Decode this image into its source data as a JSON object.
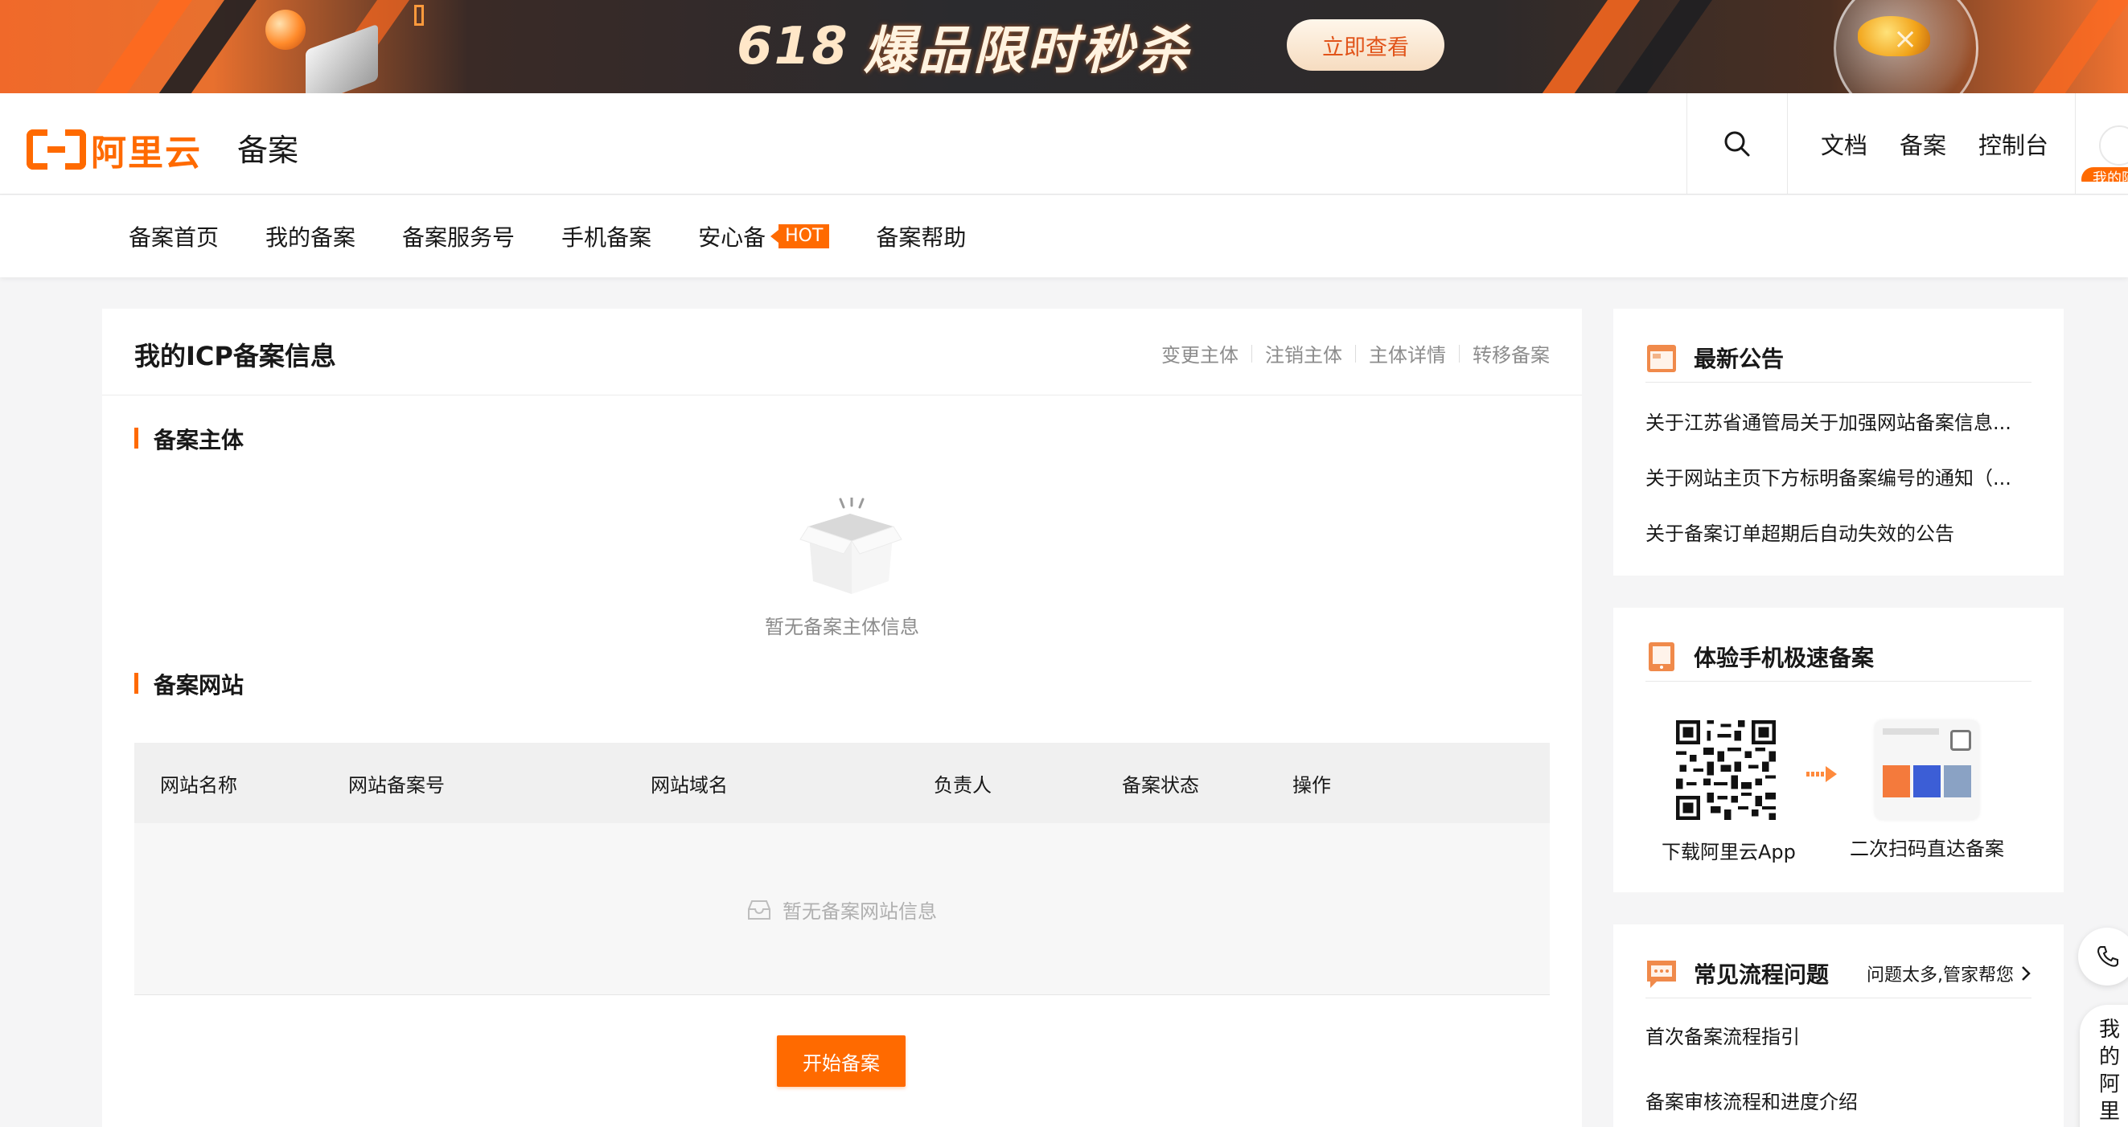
{
  "banner": {
    "promo_number": "618",
    "promo_text": "爆品限时秒杀",
    "cta_label": "立即查看"
  },
  "header": {
    "logo_text": "阿里云",
    "site_title": "备案",
    "links": [
      "文档",
      "备案",
      "控制台"
    ],
    "avatar_badge": "我的阿"
  },
  "nav": {
    "items": [
      "备案首页",
      "我的备案",
      "备案服务号",
      "手机备案",
      "安心备",
      "备案帮助"
    ],
    "hot_badge": "HOT"
  },
  "main": {
    "title": "我的ICP备案信息",
    "actions": [
      "变更主体",
      "注销主体",
      "主体详情",
      "转移备案"
    ],
    "section_subject": "备案主体",
    "subject_empty": "暂无备案主体信息",
    "section_sites": "备案网站",
    "table": {
      "columns": [
        "网站名称",
        "网站备案号",
        "网站域名",
        "负责人",
        "备案状态",
        "操作"
      ],
      "empty_text": "暂无备案网站信息"
    },
    "start_button": "开始备案"
  },
  "sidebar": {
    "announcements": {
      "title": "最新公告",
      "items": [
        "关于江苏省通管局关于加强网站备案信息...",
        "关于网站主页下方标明备案编号的通知（...",
        "关于备案订单超期后自动失效的公告"
      ]
    },
    "mobile": {
      "title": "体验手机极速备案",
      "qr_label": "下载阿里云App",
      "phone_label": "二次扫码直达备案"
    },
    "faq": {
      "title": "常见流程问题",
      "help_link": "问题太多,管家帮您",
      "items": [
        "首次备案流程指引",
        "备案审核流程和进度介绍"
      ]
    }
  },
  "float": {
    "mine_label": "我的阿里"
  },
  "colors": {
    "brand": "#ff6a00",
    "muted_text": "#8c8c8c",
    "page_bg": "#f5f5f6"
  }
}
